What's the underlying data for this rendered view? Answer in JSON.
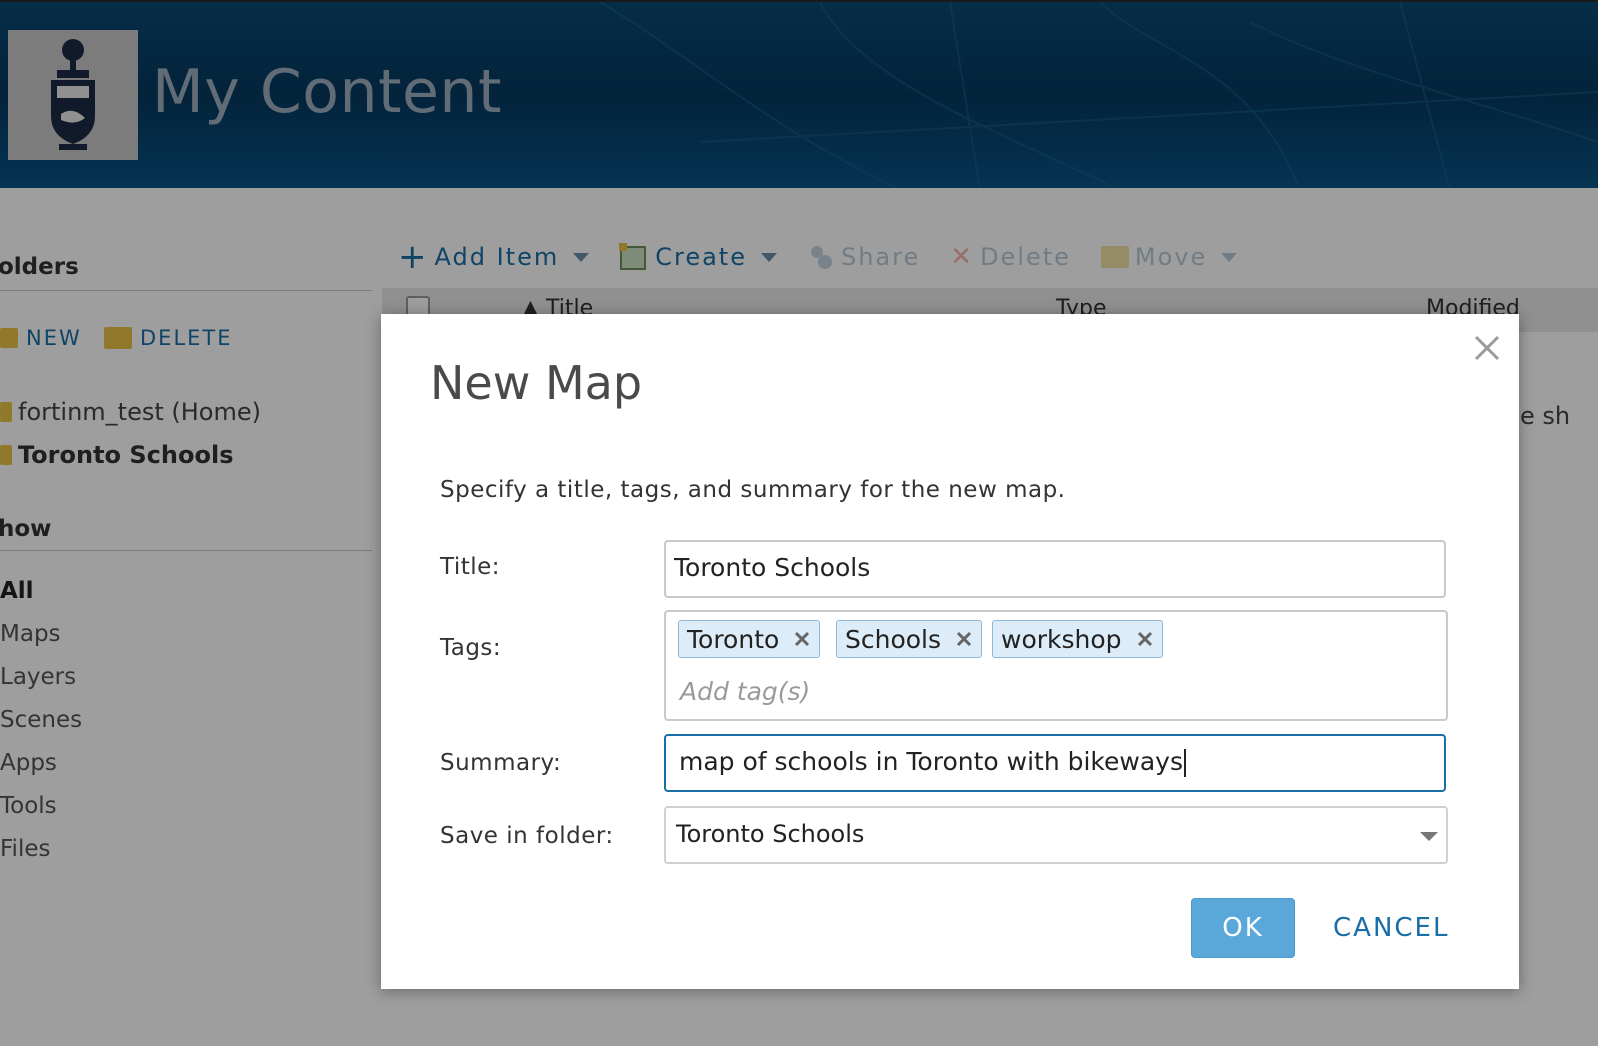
{
  "header": {
    "title": "My Content"
  },
  "sidebar": {
    "folders_title": "olders",
    "new_label": "NEW",
    "delete_label": "DELETE",
    "folders": [
      {
        "label": "fortinm_test (Home)"
      },
      {
        "label": "Toronto Schools"
      }
    ],
    "show_title": "how",
    "show_items": [
      {
        "label": "All"
      },
      {
        "label": "Maps"
      },
      {
        "label": "Layers"
      },
      {
        "label": "Scenes"
      },
      {
        "label": "Apps"
      },
      {
        "label": "Tools"
      },
      {
        "label": "Files"
      }
    ]
  },
  "toolbar": {
    "add_item": "Add Item",
    "create": "Create",
    "share": "Share",
    "delete": "Delete",
    "move": "Move"
  },
  "table": {
    "col_title": "Title",
    "col_type": "Type",
    "col_modified": "Modified",
    "partial_text": "e sh"
  },
  "dialog": {
    "title": "New Map",
    "description": "Specify a title, tags, and summary for the new map.",
    "title_label": "Title:",
    "title_value": "Toronto Schools",
    "tags_label": "Tags:",
    "tags": [
      "Toronto",
      "Schools",
      "workshop"
    ],
    "tags_placeholder": "Add tag(s)",
    "summary_label": "Summary:",
    "summary_value": "map of schools in Toronto with bikeways",
    "folder_label": "Save in folder:",
    "folder_value": "Toronto Schools",
    "ok_label": "OK",
    "cancel_label": "CANCEL"
  },
  "colors": {
    "accent": "#1a6ea6",
    "ok_button": "#5aa7d9",
    "header_bg": "#05395f",
    "tag_bg": "#dcecf8"
  }
}
